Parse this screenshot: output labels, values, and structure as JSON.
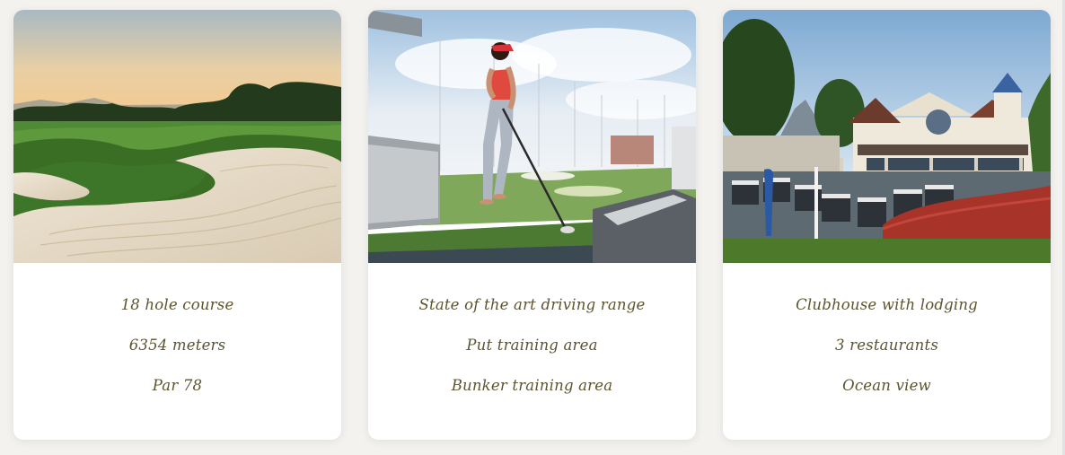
{
  "cards": [
    {
      "image": "golf-course-bunker-sunset",
      "features": [
        "18 hole course",
        "6354 meters",
        "Par 78"
      ]
    },
    {
      "image": "driving-range-golfer",
      "features": [
        "State of the art driving range",
        "Put training area",
        "Bunker training area"
      ]
    },
    {
      "image": "clubhouse-with-golf-carts",
      "features": [
        "Clubhouse with lodging",
        "3 restaurants",
        "Ocean view"
      ]
    }
  ],
  "colors": {
    "background": "#f3f2ef",
    "card": "#ffffff",
    "text": "#5c5430",
    "fairway": "#3f7a2c",
    "sand": "#e4d8c4",
    "sky_dusk": "#f1c891",
    "sky_day": "#cfe2f2",
    "turf": "#41642e",
    "hedge": "#b03a30"
  }
}
